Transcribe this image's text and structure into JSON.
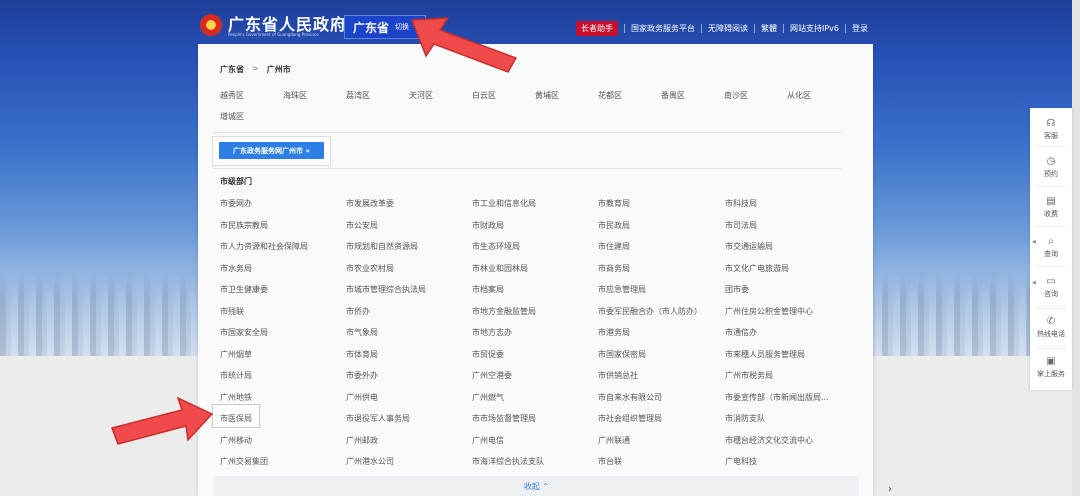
{
  "header": {
    "site_title": "广东省人民政府",
    "site_subtitle": "People's Government of Guangdong Province",
    "region_name": "广东省",
    "region_switch": "切换 ⌃",
    "elder_helper": "长者助手",
    "nav_links": [
      "国家政务服务平台",
      "无障碍阅读",
      "繁體",
      "网站支持IPv6",
      "登录"
    ]
  },
  "panel": {
    "breadcrumb": {
      "province": "广东省",
      "separator": ">",
      "city": "广州市"
    },
    "districts": [
      "越秀区",
      "海珠区",
      "荔湾区",
      "天河区",
      "白云区",
      "黄埔区",
      "花都区",
      "番禺区",
      "南沙区",
      "从化区",
      "增城区"
    ],
    "portal_link": "广东政务服务网广州市 »",
    "dept_section_title": "市级部门",
    "departments": [
      "市委网办",
      "市发展改革委",
      "市工业和信息化局",
      "市教育局",
      "市科技局",
      "市民族宗教局",
      "市公安局",
      "市财政局",
      "市民政局",
      "市司法局",
      "市人力资源和社会保障局",
      "市规划和自然资源局",
      "市生态环境局",
      "市住建局",
      "市交通运输局",
      "市水务局",
      "市农业农村局",
      "市林业和园林局",
      "市商务局",
      "市文化广电旅游局",
      "市卫生健康委",
      "市城市管理综合执法局",
      "市档案局",
      "市应急管理局",
      "团市委",
      "市残联",
      "市侨办",
      "市地方金融监管局",
      "市委军民融合办（市人防办）",
      "广州住房公积金管理中心",
      "市国家安全局",
      "市气象局",
      "市地方志办",
      "市港务局",
      "市通信办",
      "广州烟草",
      "市体育局",
      "市贸促委",
      "市国家保密局",
      "市来穗人员服务管理局",
      "市统计局",
      "市委外办",
      "广州空港委",
      "市供销总社",
      "广州市税务局",
      "广州地铁",
      "广州供电",
      "广州燃气",
      "市自来水有限公司",
      "市委宣传部（市新闻出版局...",
      "市医保局",
      "市退役军人事务局",
      "市市场监督管理局",
      "市社会组织管理局",
      "市消防支队",
      "广州移动",
      "广州邮政",
      "广州电信",
      "广州联通",
      "市穗台经济文化交流中心",
      "广州交易集团",
      "广州港水公司",
      "市海洋综合执法支队",
      "市台联",
      "广电科技"
    ],
    "collapse_label": "收起 ⌃"
  },
  "sidebar": {
    "items": [
      {
        "icon": "headset-icon",
        "label": "客服"
      },
      {
        "icon": "clock-icon",
        "label": "预约"
      },
      {
        "icon": "doc-icon",
        "label": "收费"
      },
      {
        "icon": "search-icon",
        "label": "查询"
      },
      {
        "icon": "chat-icon",
        "label": "咨询"
      },
      {
        "icon": "phone-icon",
        "label": "热线电话"
      },
      {
        "icon": "doc-icon",
        "label": "掌上服务"
      }
    ]
  },
  "colors": {
    "header_blue": "#1f3f9a",
    "region_btn": "#1a44c9",
    "portal_btn": "#2d7fe4",
    "elder_red": "#c8102e",
    "callout_red": "#f04a4a"
  }
}
